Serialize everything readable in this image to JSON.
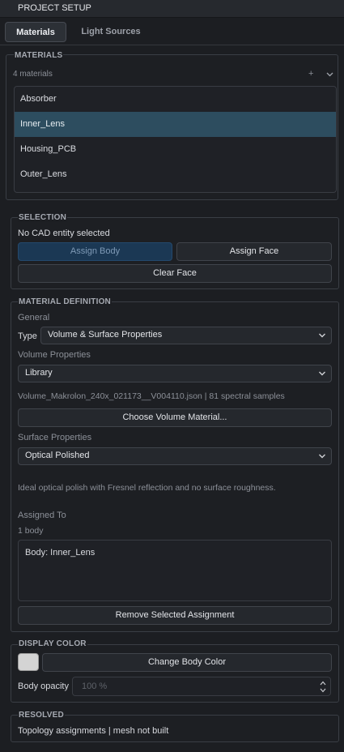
{
  "window": {
    "title": "PROJECT SETUP"
  },
  "tabs": [
    {
      "label": "Materials"
    },
    {
      "label": "Light Sources"
    }
  ],
  "materials": {
    "title": "MATERIALS",
    "count": "4 materials",
    "add_glyph": "+",
    "items": [
      {
        "label": "Absorber"
      },
      {
        "label": "Inner_Lens"
      },
      {
        "label": "Housing_PCB"
      },
      {
        "label": "Outer_Lens"
      }
    ],
    "selected_index": 1
  },
  "selection": {
    "title": "SELECTION",
    "status": "No CAD entity selected",
    "assign_body": "Assign Body",
    "assign_face": "Assign Face",
    "clear_face": "Clear Face"
  },
  "definition": {
    "title": "MATERIAL DEFINITION",
    "general": "General",
    "type_label": "Type",
    "type_value": "Volume & Surface Properties",
    "volume_label": "Volume Properties",
    "volume_value": "Library",
    "volume_file": "Volume_Makrolon_240x_021173__V004110.json | 81 spectral samples",
    "choose_volume": "Choose Volume Material...",
    "surface_label": "Surface Properties",
    "surface_value": "Optical Polished",
    "surface_desc": "Ideal optical polish with Fresnel reflection and no surface roughness.",
    "assigned_label": "Assigned To",
    "assigned_count": "1 body",
    "assigned_item": "Body: Inner_Lens",
    "remove_assignment": "Remove Selected Assignment"
  },
  "display": {
    "title": "DISPLAY COLOR",
    "swatch_color": "#d4d4d4",
    "change_color": "Change Body Color",
    "opacity_label": "Body opacity",
    "opacity_value": "100 %"
  },
  "resolved": {
    "title": "RESOLVED",
    "status": "Topology assignments | mesh not built"
  }
}
